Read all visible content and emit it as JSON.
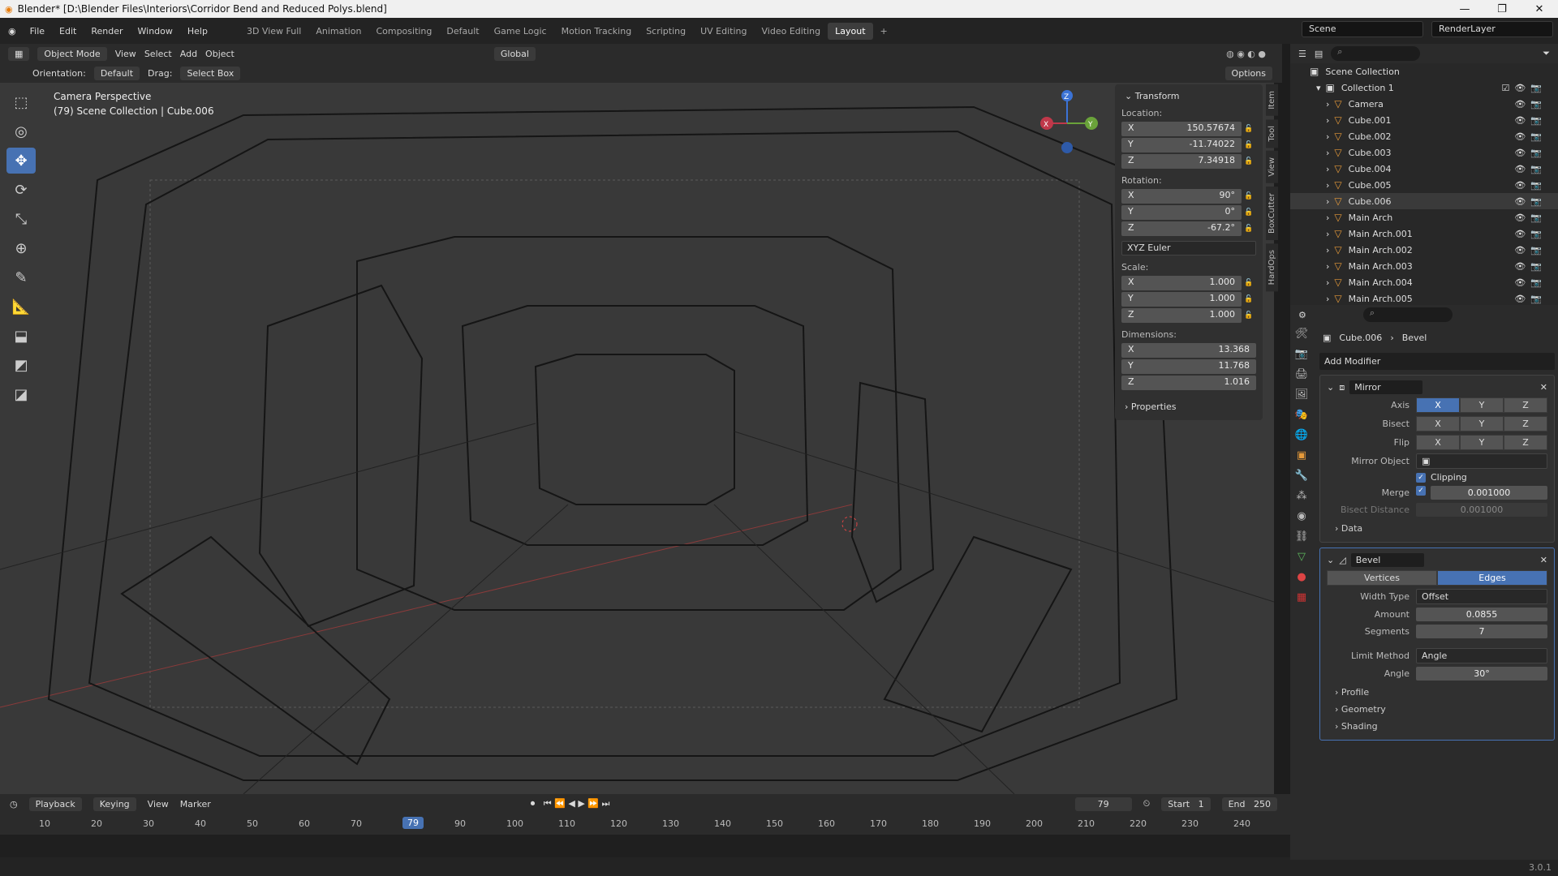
{
  "window": {
    "title": "Blender* [D:\\Blender Files\\Interiors\\Corridor Bend and Reduced Polys.blend]"
  },
  "menu": [
    "File",
    "Edit",
    "Render",
    "Window",
    "Help"
  ],
  "workspaces": [
    "3D View Full",
    "Animation",
    "Compositing",
    "Default",
    "Game Logic",
    "Motion Tracking",
    "Scripting",
    "UV Editing",
    "Video Editing",
    "Layout"
  ],
  "active_workspace": "Layout",
  "scene": {
    "name": "Scene",
    "render_layer": "RenderLayer"
  },
  "viewport_header": {
    "mode": "Object Mode",
    "view": "View",
    "select": "Select",
    "add": "Add",
    "object": "Object",
    "transform": "Global",
    "orientation_label": "Orientation:",
    "orientation": "Default",
    "drag_label": "Drag:",
    "drag": "Select Box",
    "options": "Options"
  },
  "viewport_info": {
    "line1": "Camera Perspective",
    "line2": "(79) Scene Collection | Cube.006"
  },
  "npanel": {
    "transform_title": "Transform",
    "location_label": "Location:",
    "location": {
      "x": "150.57674",
      "y": "-11.74022",
      "z": "7.34918"
    },
    "rotation_label": "Rotation:",
    "rotation": {
      "x": "90°",
      "y": "0°",
      "z": "-67.2°"
    },
    "rotation_mode": "XYZ Euler",
    "scale_label": "Scale:",
    "scale": {
      "x": "1.000",
      "y": "1.000",
      "z": "1.000"
    },
    "dimensions_label": "Dimensions:",
    "dimensions": {
      "x": "13.368",
      "y": "11.768",
      "z": "1.016"
    },
    "properties_title": "Properties",
    "tabs": [
      "Item",
      "Tool",
      "View",
      "BoxCutter",
      "HardOps"
    ]
  },
  "axis_letters": {
    "x": "X",
    "y": "Y",
    "z": "Z"
  },
  "outliner": {
    "root": "Scene Collection",
    "collection": "Collection 1",
    "items": [
      "Camera",
      "Cube.001",
      "Cube.002",
      "Cube.003",
      "Cube.004",
      "Cube.005",
      "Cube.006",
      "Main Arch",
      "Main Arch.001",
      "Main Arch.002",
      "Main Arch.003",
      "Main Arch.004",
      "Main Arch.005"
    ]
  },
  "properties": {
    "object": "Cube.006",
    "modifier_crumb": "Bevel",
    "add_modifier": "Add Modifier",
    "mirror": {
      "name": "Mirror",
      "axis_label": "Axis",
      "bisect_label": "Bisect",
      "flip_label": "Flip",
      "mirror_object_label": "Mirror Object",
      "clipping": "Clipping",
      "merge_label": "Merge",
      "merge": "0.001000",
      "bisect_distance_label": "Bisect Distance",
      "bisect_distance": "0.001000",
      "data": "Data"
    },
    "bevel": {
      "name": "Bevel",
      "vertices": "Vertices",
      "edges": "Edges",
      "width_type_label": "Width Type",
      "width_type": "Offset",
      "amount_label": "Amount",
      "amount": "0.0855",
      "segments_label": "Segments",
      "segments": "7",
      "limit_method_label": "Limit Method",
      "limit_method": "Angle",
      "angle_label": "Angle",
      "angle": "30°",
      "profile": "Profile",
      "geometry": "Geometry",
      "shading": "Shading"
    }
  },
  "timeline": {
    "menus": [
      "Playback",
      "Keying",
      "View",
      "Marker"
    ],
    "current_frame": "79",
    "start_label": "Start",
    "start": "1",
    "end_label": "End",
    "end": "250",
    "ticks": [
      "10",
      "20",
      "30",
      "40",
      "50",
      "60",
      "70",
      "79",
      "90",
      "100",
      "110",
      "120",
      "130",
      "140",
      "150",
      "160",
      "170",
      "180",
      "190",
      "200",
      "210",
      "220",
      "230",
      "240"
    ]
  },
  "version": "3.0.1"
}
